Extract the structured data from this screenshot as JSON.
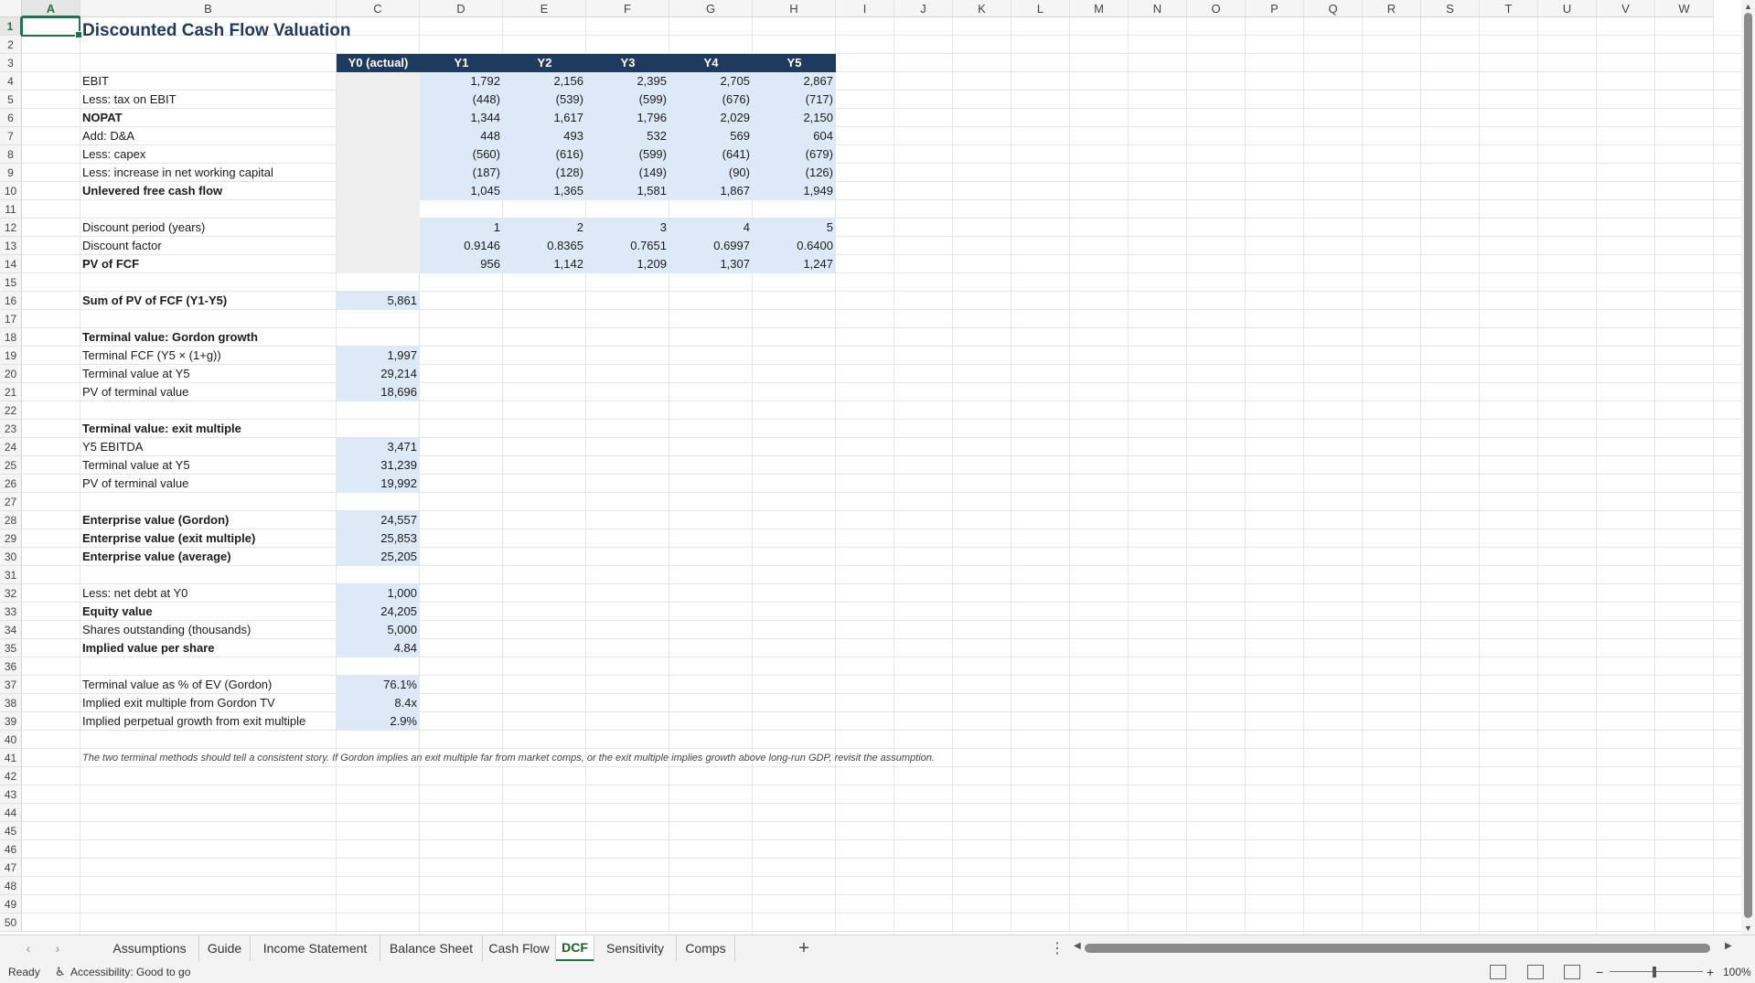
{
  "columns": [
    "A",
    "B",
    "C",
    "D",
    "E",
    "F",
    "G",
    "H",
    "I",
    "J",
    "K",
    "L",
    "M",
    "N",
    "O",
    "P",
    "Q",
    "R",
    "S",
    "T",
    "U",
    "V",
    "W"
  ],
  "rows": [
    "1",
    "2",
    "3",
    "4",
    "5",
    "6",
    "7",
    "8",
    "9",
    "10",
    "11",
    "12",
    "13",
    "14",
    "15",
    "16",
    "17",
    "18",
    "19",
    "20",
    "21",
    "22",
    "23",
    "24",
    "25",
    "26",
    "27",
    "28",
    "29",
    "30",
    "31",
    "32",
    "33",
    "34",
    "35",
    "36",
    "37",
    "38",
    "39",
    "40",
    "41",
    "42",
    "43",
    "44",
    "45",
    "46",
    "47",
    "48",
    "49",
    "50"
  ],
  "selected_cell": "A1",
  "title": "Discounted Cash Flow Valuation",
  "header_row": [
    "Y0 (actual)",
    "Y1",
    "Y2",
    "Y3",
    "Y4",
    "Y5"
  ],
  "cash_flow": [
    {
      "label": "EBIT",
      "bold": false,
      "values": [
        "1,792",
        "2,156",
        "2,395",
        "2,705",
        "2,867"
      ]
    },
    {
      "label": "Less: tax on EBIT",
      "bold": false,
      "values": [
        "(448)",
        "(539)",
        "(599)",
        "(676)",
        "(717)"
      ]
    },
    {
      "label": "NOPAT",
      "bold": true,
      "values": [
        "1,344",
        "1,617",
        "1,796",
        "2,029",
        "2,150"
      ]
    },
    {
      "label": "Add: D&A",
      "bold": false,
      "values": [
        "448",
        "493",
        "532",
        "569",
        "604"
      ]
    },
    {
      "label": "Less: capex",
      "bold": false,
      "values": [
        "(560)",
        "(616)",
        "(599)",
        "(641)",
        "(679)"
      ]
    },
    {
      "label": "Less: increase in net working capital",
      "bold": false,
      "values": [
        "(187)",
        "(128)",
        "(149)",
        "(90)",
        "(126)"
      ]
    },
    {
      "label": "Unlevered free cash flow",
      "bold": true,
      "values": [
        "1,045",
        "1,365",
        "1,581",
        "1,867",
        "1,949"
      ]
    }
  ],
  "discounting": [
    {
      "label": "Discount period (years)",
      "bold": false,
      "values": [
        "1",
        "2",
        "3",
        "4",
        "5"
      ]
    },
    {
      "label": "Discount factor",
      "bold": false,
      "values": [
        "0.9146",
        "0.8365",
        "0.7651",
        "0.6997",
        "0.6400"
      ]
    },
    {
      "label": "PV of FCF",
      "bold": true,
      "values": [
        "956",
        "1,142",
        "1,209",
        "1,307",
        "1,247"
      ]
    }
  ],
  "sum_pv": {
    "label": "Sum of PV of FCF (Y1-Y5)",
    "value": "5,861"
  },
  "gordon": {
    "heading": "Terminal value: Gordon growth",
    "items": [
      {
        "label": "Terminal FCF (Y5 × (1+g))",
        "value": "1,997"
      },
      {
        "label": "Terminal value at Y5",
        "value": "29,214"
      },
      {
        "label": "PV of terminal value",
        "value": "18,696"
      }
    ]
  },
  "exit_multiple": {
    "heading": "Terminal value: exit multiple",
    "items": [
      {
        "label": "Y5 EBITDA",
        "value": "3,471"
      },
      {
        "label": "Terminal value at Y5",
        "value": "31,239"
      },
      {
        "label": "PV of terminal value",
        "value": "19,992"
      }
    ]
  },
  "enterprise": [
    {
      "label": "Enterprise value (Gordon)",
      "bold": true,
      "value": "24,557"
    },
    {
      "label": "Enterprise value (exit multiple)",
      "bold": true,
      "value": "25,853"
    },
    {
      "label": "Enterprise value (average)",
      "bold": true,
      "value": "25,205"
    }
  ],
  "equity": [
    {
      "label": "Less: net debt at Y0",
      "bold": false,
      "value": "1,000"
    },
    {
      "label": "Equity value",
      "bold": true,
      "value": "24,205"
    },
    {
      "label": "Shares outstanding (thousands)",
      "bold": false,
      "value": "5,000"
    },
    {
      "label": "Implied value per share",
      "bold": true,
      "value": "4.84"
    }
  ],
  "checks": [
    {
      "label": "Terminal value as % of EV (Gordon)",
      "value": "76.1%"
    },
    {
      "label": "Implied exit multiple from Gordon TV",
      "value": "8.4x"
    },
    {
      "label": "Implied perpetual growth from exit multiple",
      "value": "2.9%"
    }
  ],
  "note": "The two terminal methods should tell a consistent story. If Gordon implies an exit multiple far from market comps, or the exit multiple implies growth above long-run GDP, revisit the assumption.",
  "sheet_tabs": [
    "Assumptions",
    "Guide",
    "Income Statement",
    "Balance Sheet",
    "Cash Flow",
    "DCF",
    "Sensitivity",
    "Comps"
  ],
  "active_tab": "DCF",
  "status": {
    "ready": "Ready",
    "accessibility": "Accessibility: Good to go",
    "zoom": "100%"
  },
  "colors": {
    "header_fill": "#1f3a5f",
    "input_fill": "#dde9f7",
    "grey_fill": "#efefef",
    "excel_green": "#217346"
  }
}
